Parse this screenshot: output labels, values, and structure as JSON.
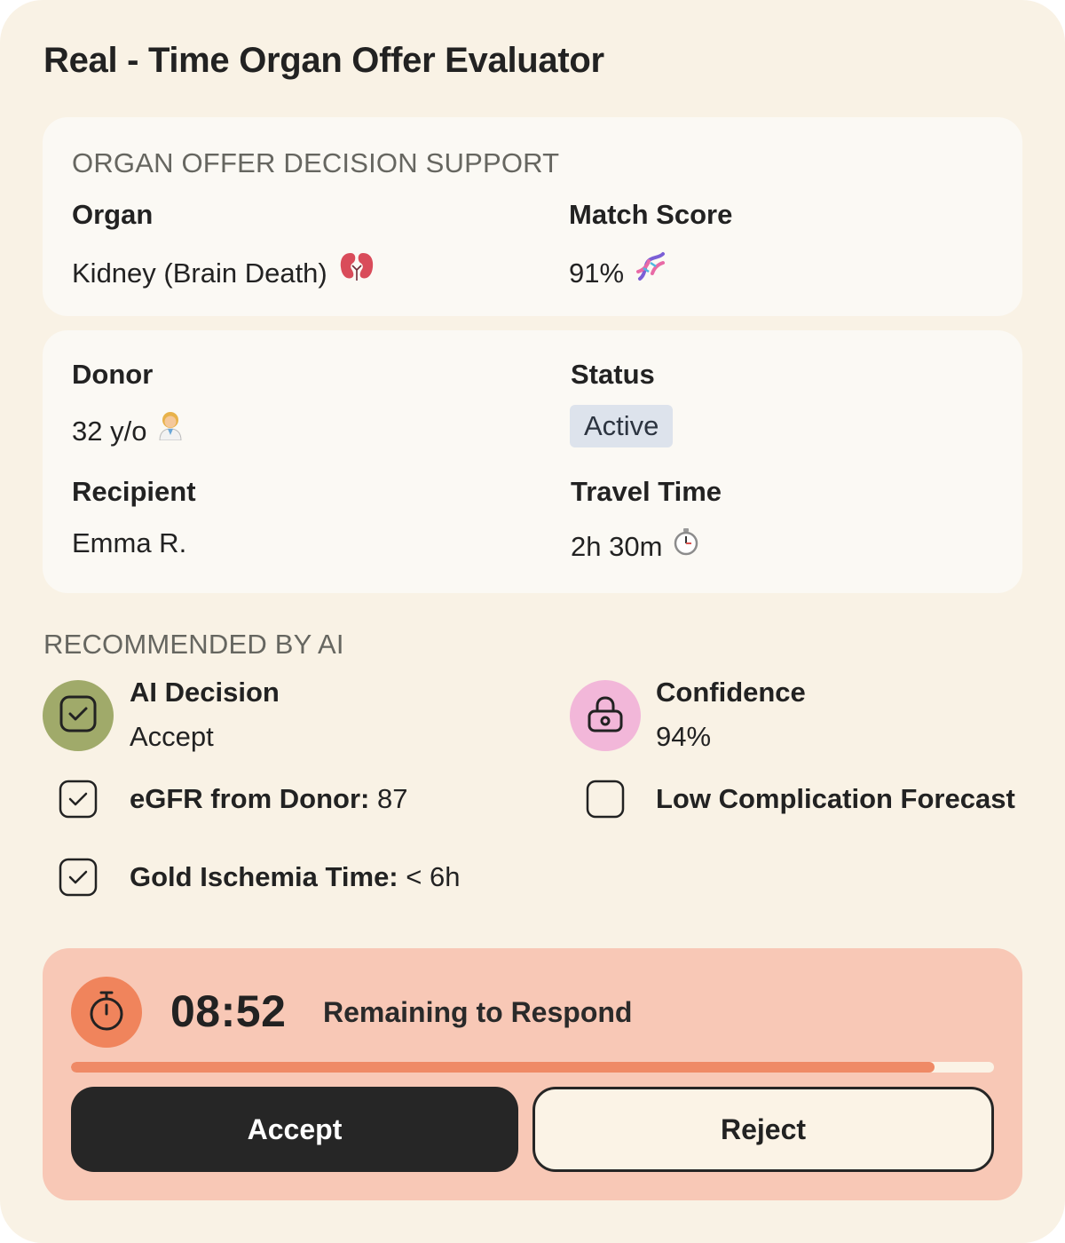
{
  "app": {
    "title": "Real - Time Organ Offer Evaluator"
  },
  "offer_panel": {
    "section_label": "ORGAN OFFER DECISION SUPPORT",
    "organ_label": "Organ",
    "organ_value": "Kidney (Brain Death)",
    "organ_emoji": "🫘",
    "match_score_label": "Match Score",
    "match_score_value": "91%",
    "match_score_emoji": "🧬"
  },
  "details_panel": {
    "donor_label": "Donor",
    "donor_value": "32 y/o",
    "donor_emoji": "👩",
    "status_label": "Status",
    "status_value": "Active",
    "recipient_label": "Recipient",
    "recipient_value": "Emma R.",
    "travel_label": "Travel Time",
    "travel_value": "2h 30m",
    "travel_emoji": "⏱"
  },
  "ai": {
    "section_label": "RECOMMENDED BY AI",
    "decision_label": "AI Decision",
    "decision_value": "Accept",
    "decision_icon": "check-square-icon",
    "confidence_label": "Confidence",
    "confidence_value": "94%",
    "confidence_icon": "lock-icon",
    "checks": [
      {
        "label": "eGFR from Donor:",
        "value": "87",
        "checked": true
      },
      {
        "label": "Low Complication Forecast",
        "value": "",
        "checked": false
      },
      {
        "label": "Gold Ischemia Time:",
        "value": "< 6h",
        "checked": true
      }
    ]
  },
  "timer": {
    "icon": "stopwatch-icon",
    "countdown": "08:52",
    "label": "Remaining to Respond",
    "progress_fraction": 0.936,
    "accept_label": "Accept",
    "reject_label": "Reject"
  },
  "colors": {
    "background": "#f9f2e5",
    "panel": "#fbf9f4",
    "decision_circle": "#a0aa6a",
    "confidence_circle": "#f2b7d9",
    "timer_panel": "#f8c8b6",
    "timer_accent": "#f0845c",
    "status_badge": "#dde3ec",
    "dark_button": "#262626"
  }
}
